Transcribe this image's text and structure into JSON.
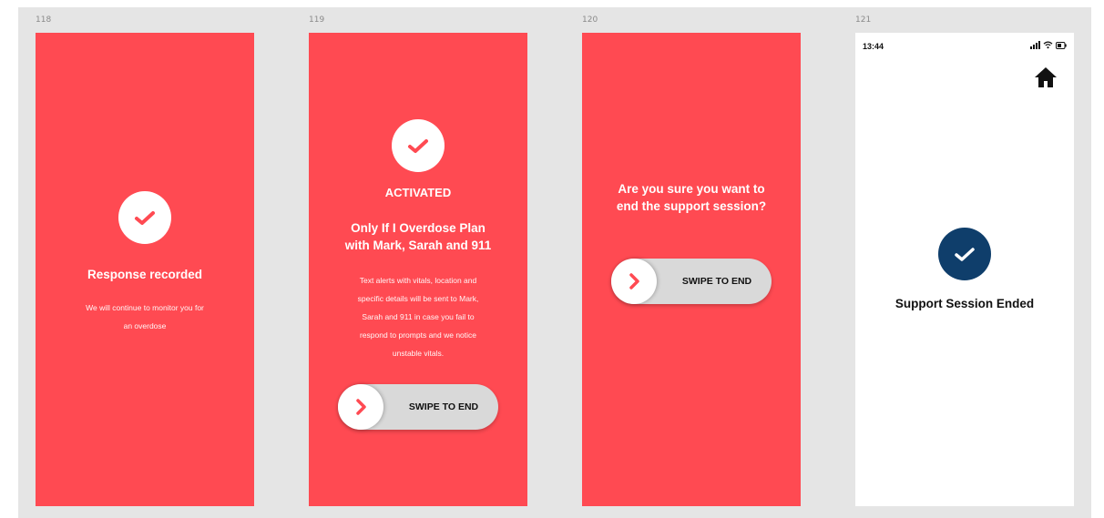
{
  "frames": [
    {
      "label": "118",
      "title": "Response recorded",
      "body_lines": [
        "We will continue to monitor you for",
        "an overdose"
      ]
    },
    {
      "label": "119",
      "status_title": "ACTIVATED",
      "plan_title_lines": [
        "Only If I Overdose Plan",
        "with Mark, Sarah and 911"
      ],
      "body_lines": [
        "Text alerts with vitals, location and",
        "specific details will be sent to Mark,",
        "Sarah and 911 in case you fail to",
        "respond to prompts and we notice",
        "unstable vitals."
      ],
      "swipe_label": "SWIPE TO END"
    },
    {
      "label": "120",
      "question_lines": [
        "Are you sure you want to",
        "end the support session?"
      ],
      "swipe_label": "SWIPE TO END"
    },
    {
      "label": "121",
      "status_time": "13:44",
      "title": "Support Session Ended"
    }
  ],
  "colors": {
    "red": "#ff4a52",
    "navy": "#0f3e6b",
    "canvas": "#e5e5e5",
    "swipe_track": "#d9d9d9"
  },
  "icons": [
    "check-icon",
    "chevron-right-icon",
    "home-icon",
    "signal-icon",
    "wifi-icon",
    "battery-icon"
  ]
}
